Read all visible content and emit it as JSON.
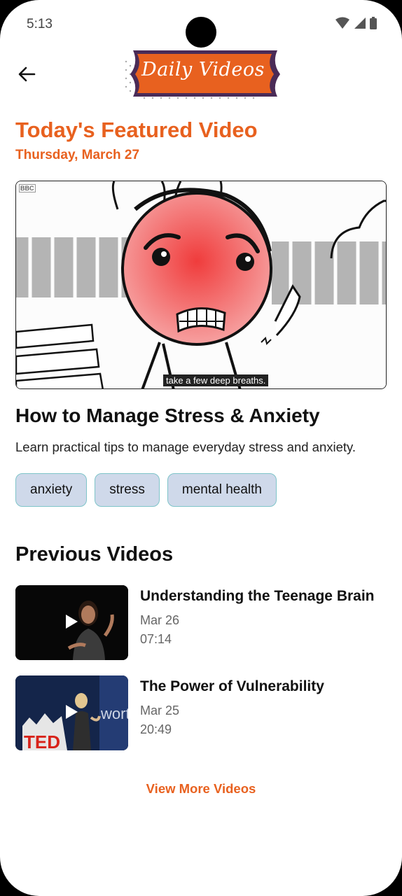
{
  "status_bar": {
    "time": "5:13"
  },
  "header": {
    "logo_text": "Daily Videos"
  },
  "featured": {
    "section_title": "Today's Featured Video",
    "date": "Thursday, March 27",
    "badge": "BBC",
    "caption": "take a few deep breaths.",
    "title": "How to Manage Stress & Anxiety",
    "description": "Learn practical tips to manage everyday stress and anxiety.",
    "tags": [
      "anxiety",
      "stress",
      "mental health"
    ]
  },
  "previous": {
    "heading": "Previous Videos",
    "items": [
      {
        "title": "Understanding the Teenage Brain",
        "date": "Mar 26",
        "duration": "07:14"
      },
      {
        "title": "The Power of Vulnerability",
        "date": "Mar 25",
        "duration": "20:49"
      }
    ]
  },
  "view_more_label": "View More Videos",
  "colors": {
    "accent": "#e8611f",
    "tag_bg": "#cfd9ea",
    "tag_border": "#7fc4c9"
  }
}
